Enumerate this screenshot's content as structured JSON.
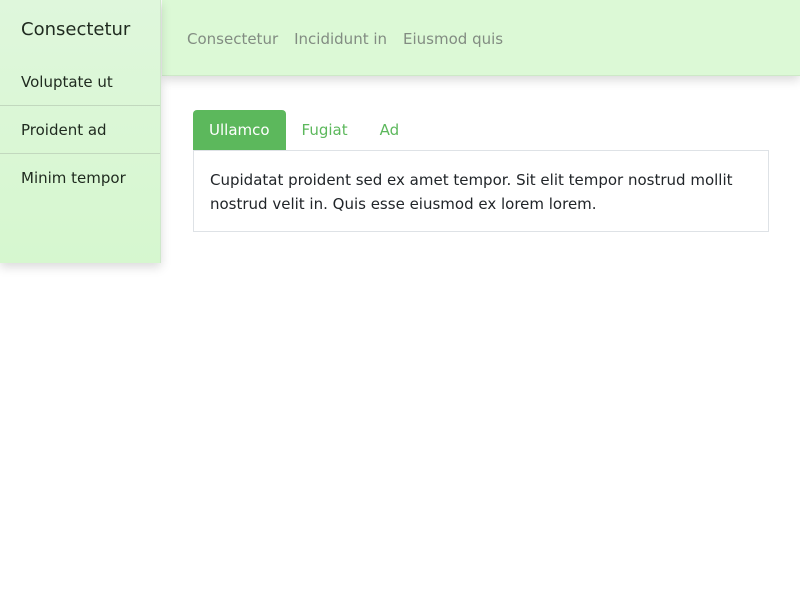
{
  "sidebar": {
    "brand": "Consectetur",
    "items": [
      {
        "label": "Voluptate ut"
      },
      {
        "label": "Proident ad"
      },
      {
        "label": "Minim tempor"
      }
    ]
  },
  "topbar": {
    "links": [
      {
        "label": "Consectetur"
      },
      {
        "label": "Incididunt in"
      },
      {
        "label": "Eiusmod quis"
      }
    ]
  },
  "tabs": {
    "items": [
      {
        "label": "Ullamco",
        "active": true
      },
      {
        "label": "Fugiat",
        "active": false
      },
      {
        "label": "Ad",
        "active": false
      }
    ],
    "panel_text": "Cupidatat proident sed ex amet tempor. Sit elit tempor nostrud mollit nostrud velit in. Quis esse eiusmod ex lorem lorem."
  },
  "colors": {
    "accent": "#5cb85c",
    "nav_background": "#dcf9d6",
    "sidebar_background": "#dff7dc"
  }
}
